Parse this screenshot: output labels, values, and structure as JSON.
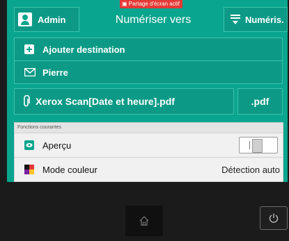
{
  "header": {
    "admin_label": "Admin",
    "title": "Numériser vers",
    "share_banner": "Partage d'écran actif",
    "numeris_label": "Numéris."
  },
  "destinations": {
    "add_label": "Ajouter destination",
    "recipient": "Pierre"
  },
  "file": {
    "name": "Xerox Scan[Date et heure].pdf",
    "format": ".pdf"
  },
  "features": {
    "heading": "Fonctions courantes",
    "preview_label": "Aperçu",
    "color_mode_label": "Mode couleur",
    "color_mode_value": "Détection auto"
  },
  "icons": {
    "admin": "user-icon",
    "numeris": "scan-icon",
    "add": "plus-icon",
    "recipient": "envelope-icon",
    "file": "paperclip-icon",
    "preview": "eye-icon",
    "color": "color-swatch-icon",
    "home": "home-icon",
    "power": "power-icon"
  },
  "colors": {
    "accent": "#0aa58e",
    "banner": "#e53935"
  }
}
